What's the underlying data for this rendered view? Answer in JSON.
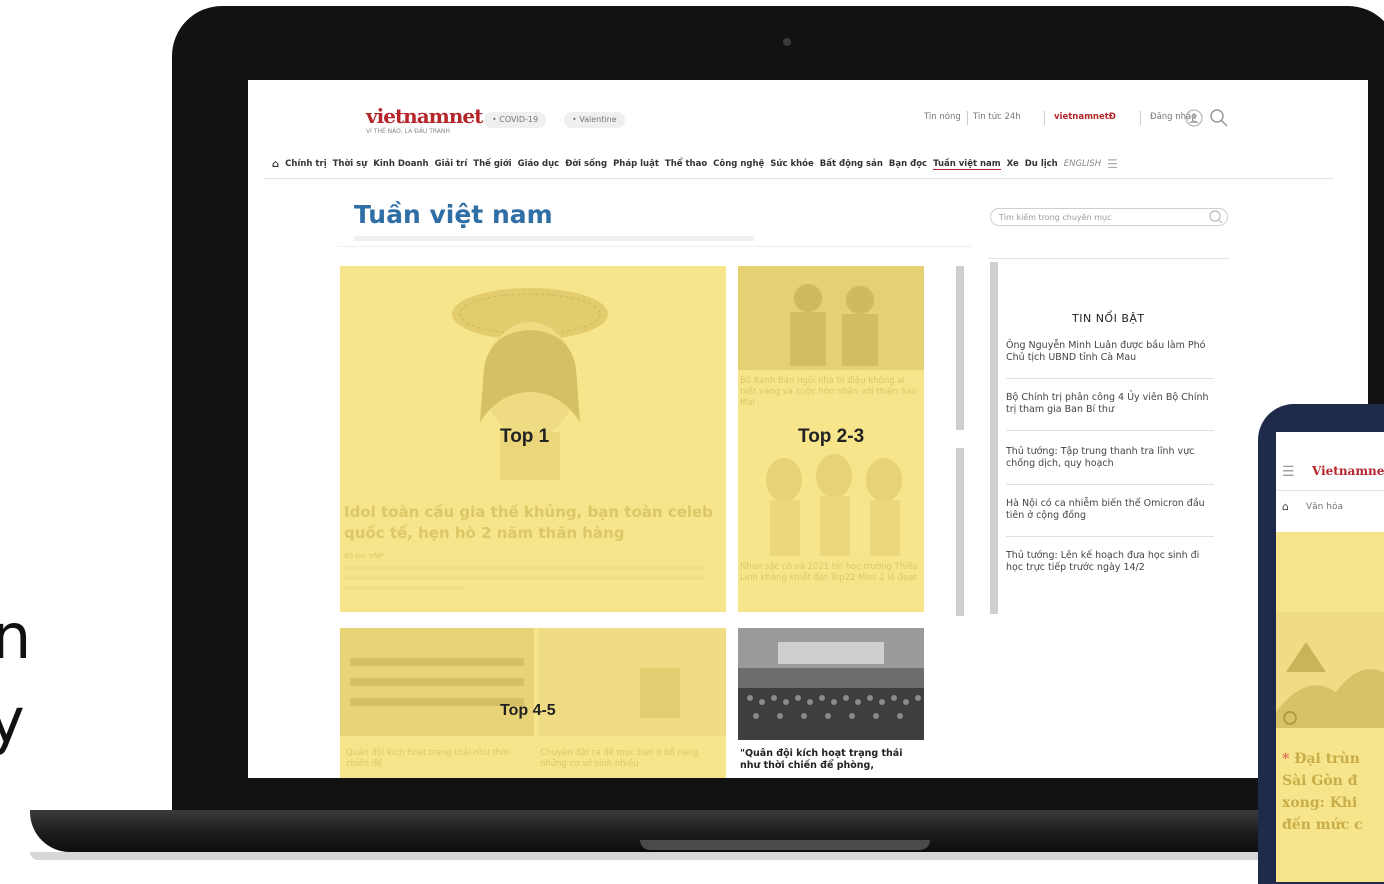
{
  "left_edge": {
    "char1": "n",
    "char2": "y"
  },
  "site": {
    "logo_text": "vietnamnet",
    "logo_tagline": "VI THẾ NÀO, LÀ ĐẤU TRANH",
    "tags": [
      "• COVID-19",
      "• Valentine"
    ],
    "top_links": [
      "Tin nóng",
      "Tin tức 24h",
      "vietnamnetĐ",
      "Đăng nhập"
    ],
    "nav": [
      "Chính trị",
      "Thời sự",
      "Kinh Doanh",
      "Giải trí",
      "Thế giới",
      "Giáo dục",
      "Đời sống",
      "Pháp luật",
      "Thể thao",
      "Công nghệ",
      "Sức khỏe",
      "Bất động sản",
      "Bạn đọc",
      "Tuần việt nam",
      "Xe",
      "Du lịch",
      "ENGLISH"
    ],
    "page_title": "Tuần việt nam",
    "search_placeholder": "Tìm kiếm trong chuyên mục"
  },
  "tiles": {
    "top1": {
      "label": "Top 1",
      "headline": "Idol toàn cầu gia thế khủng, bạn toàn celeb quốc tế, hẹn hò 2 năm thăn hàng",
      "author": "Bộ tin: VNP"
    },
    "top23": {
      "label": "Top 2-3",
      "headline_a": "Bố Kanh Bán ngôi nhà bí điệu không ai biết vàng và cuộc hôn nhân với thiên Sao Mai",
      "headline_b": "Nhan sắc cô và 2021 tin học trường Thiều Linh kháng khiết đạt Top22 Miss 2 lệ đoạt"
    },
    "top45": {
      "label": "Top 4-5",
      "caption_a": "Quân đội kích hoạt trạng thái như thời chiến để",
      "caption_b": "Chuyện đặt ra để mục bạn ở bố nang những cơ sở sinh nhiều"
    },
    "extra": {
      "caption": "\"Quân đội kích hoạt trạng thái như thời chiến để phòng,"
    }
  },
  "sidebar": {
    "title": "TIN NỔI BẬT",
    "items": [
      "Ông Nguyễn Minh Luân được bầu làm Phó Chủ tịch UBND tỉnh Cà Mau",
      "Bộ Chính trị phân công 4 Ủy viên Bộ Chính trị tham gia Ban Bí thư",
      "Thủ tướng: Tập trung thanh tra lĩnh vực chống dịch, quy hoạch",
      "Hà Nội có ca nhiễm biến thể Omicron đầu tiên ở cộng đồng",
      "Thủ tướng: Lên kế hoạch đưa học sinh đi học trực tiếp trước ngày 14/2"
    ]
  },
  "phone": {
    "logo_text": "Vietnamnet",
    "nav_label": "Văn hóa",
    "headline_lines": [
      "Đại trùn",
      "Sài Gòn đ",
      "xong: Khi",
      "đến mức c"
    ]
  },
  "colors": {
    "highlight": "#f7e58c",
    "brand_red": "#b5262b",
    "title_blue": "#2f6fa6",
    "laptop_bezel": "#121212",
    "phone_frame": "#1f2a4a"
  }
}
